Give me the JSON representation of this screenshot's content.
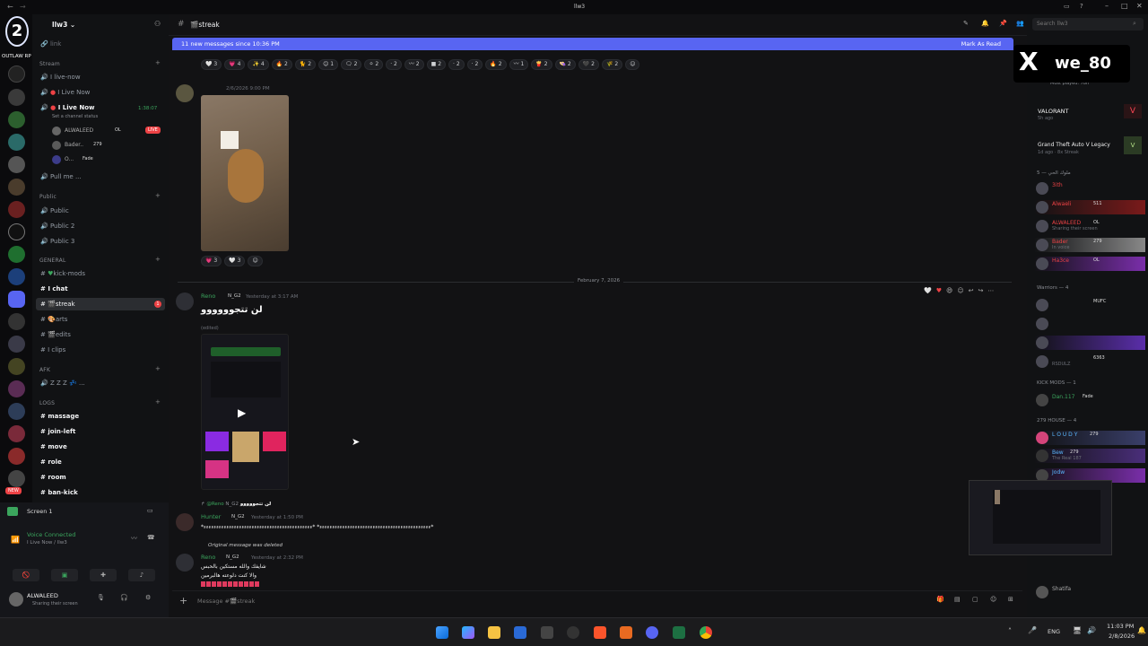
{
  "window": {
    "title": "llw3",
    "search_placeholder": "Search llw3"
  },
  "server": {
    "name": "llw3",
    "logo_text": "OUTLAW RP"
  },
  "channels": {
    "link": "link",
    "stream_category": "Stream",
    "stream": [
      "I live-now",
      "I Live Now",
      "I Live Now"
    ],
    "voice_status": "Set a channel status",
    "voice_users": [
      "ALWALEED",
      "Bader..",
      "O..."
    ],
    "voice_time": "1:38:07",
    "voice_user_tags": [
      "OL",
      "279",
      "Fade"
    ],
    "live_badge": "LIVE",
    "pull_me": "Pull me ...",
    "public_category": "Public",
    "public": [
      "Public",
      "Public 2",
      "Public 3"
    ],
    "general_category": "GENERAL",
    "general": [
      "kick-mods",
      "I chat",
      "streak",
      "arts",
      "edits",
      "I clips"
    ],
    "streak_badge": "1",
    "afk_category": "AFK",
    "afk": "Z Z Z",
    "logs_category": "LOGS",
    "logs": [
      "massage",
      "join-left",
      "move",
      "role",
      "room",
      "ban-kick"
    ]
  },
  "user_panel": {
    "screen_label": "Screen 1",
    "voice_connected": "Voice Connected",
    "voice_channel": "I Live Now / llw3",
    "username": "ALWALEED",
    "status": "Sharing their screen",
    "new_badge": "NEW"
  },
  "header": {
    "channel": "streak"
  },
  "banner": {
    "text": "11 new messages since 10:36 PM",
    "action": "Mark As Read"
  },
  "reactions_row": [
    "3",
    "4",
    "4",
    "2",
    "2",
    "1",
    "2",
    "2",
    "2",
    "2",
    "2",
    "2",
    "2",
    "2",
    "1",
    "2",
    "2",
    "2",
    "2"
  ],
  "messages": [
    {
      "author": "",
      "time": "2/6/2026 9:00 PM",
      "reactions": [
        "3",
        "3"
      ]
    },
    {
      "divider": "February 7, 2026"
    },
    {
      "author": "Reno",
      "tag": "N_G2",
      "time": "Yesterday at 3:17 AM",
      "text": "لن تتجوووووو",
      "sub": "(edited)"
    },
    {
      "reply_to": "@Reno",
      "reply_tag": "N_G2",
      "reply_text": "لن تتجووووو",
      "author": "Hunter",
      "tag": "N_G2",
      "time": "Yesterday at 1:50 PM",
      "text": "*ءءءءءءءءءءءءءءءءءءءءءءءءءءءءءءءءءءءءءءءءءءءء* *ءءءءءءءءءءءءءءءءءءءءءءءءءءءءءءءءءءءءءءءءءءء*"
    },
    {
      "deleted": "Original message was deleted",
      "author": "Reno",
      "tag": "N_G2",
      "time": "Yesterday at 2:32 PM",
      "lines": [
        "شايفك والله مستكين بالحبس",
        "والا كنت دلوعته هالبرمين"
      ]
    }
  ],
  "composer": {
    "placeholder": "Message #🎬streak"
  },
  "members": {
    "games": [
      {
        "name": "VALORANT",
        "sub": "5h ago"
      },
      {
        "name": "Grand Theft Auto V Legacy",
        "sub": "1d ago · 8x Streak"
      }
    ],
    "most_played": "Most played: 78h",
    "cat1": "ملوك الحي — 5",
    "cat1_members": [
      "3ith",
      "Alwaeli",
      "ALWALEED",
      "Bader",
      "Ha3ce"
    ],
    "cat1_status": [
      "",
      "",
      "Sharing their screen",
      "In voice",
      ""
    ],
    "cat1_tags": [
      "",
      "511",
      "OL",
      "279",
      "OL"
    ],
    "warriors": "Warriors — 4",
    "warriors_tags": [
      "MUFC",
      "",
      "",
      "6363"
    ],
    "warriors_status": [
      "",
      "",
      "",
      "RSDULZ"
    ],
    "kick_mods": "KICK MODS — 1",
    "kick_member": "Dan.117",
    "kick_tag": "Fade",
    "house": "279 HOUSE — 4",
    "house_members": [
      "L O U D Y",
      "Bew",
      "Jodw"
    ],
    "house_tags": [
      "279",
      "279",
      ""
    ],
    "house_status": [
      "",
      "The Real 187",
      ""
    ],
    "bottom_members": [
      "Shatifa"
    ]
  },
  "overlay": {
    "handle": "we_80"
  },
  "taskbar": {
    "lang": "ENG",
    "time": "11:03 PM",
    "date": "2/8/2026"
  },
  "colors": {
    "accent": "#5865f2",
    "live": "#ed4245",
    "green": "#3ba55d"
  }
}
